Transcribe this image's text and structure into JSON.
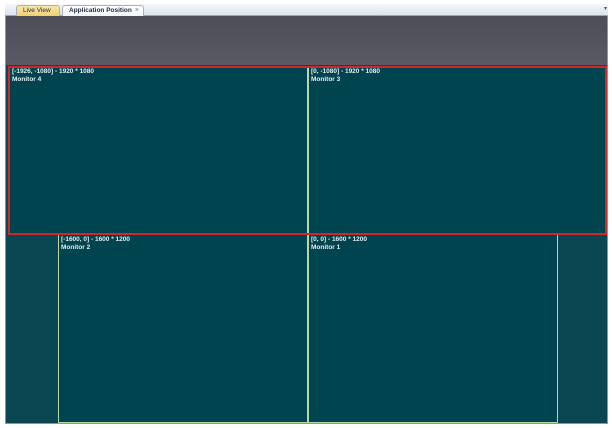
{
  "tabs": [
    {
      "label": "Live View"
    },
    {
      "label": "Application Position",
      "close": "×"
    }
  ],
  "tab_dropdown": "▾",
  "monitors": {
    "m4": {
      "coords": "[-1926, -1080] - 1920 * 1080",
      "name": "Monitor 4"
    },
    "m3": {
      "coords": "[0, -1080] - 1920 * 1080",
      "name": "Monitor 3"
    },
    "m2": {
      "coords": "[-1600, 0] - 1600 * 1200",
      "name": "Monitor 2"
    },
    "m1": {
      "coords": "[0, 0] - 1600 * 1200",
      "name": "Monitor 1"
    }
  },
  "colors": {
    "selection_border": "#d0272b",
    "monitor_fill": "#004450",
    "monitor_border": "#b9d7a3",
    "active_tab": "#efd06e"
  }
}
